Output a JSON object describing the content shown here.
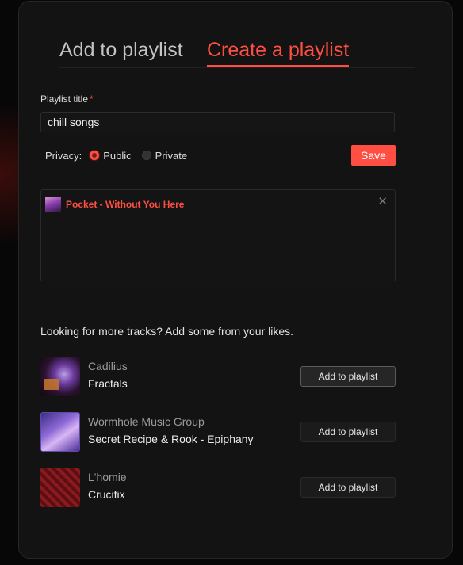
{
  "tabs": [
    {
      "label": "Add to playlist",
      "active": false
    },
    {
      "label": "Create a playlist",
      "active": true
    }
  ],
  "form": {
    "title_label": "Playlist title",
    "required_mark": "*",
    "title_value": "chill songs",
    "privacy_label": "Privacy:",
    "privacy_options": [
      "Public",
      "Private"
    ],
    "privacy_selected": "Public",
    "save_label": "Save"
  },
  "selected_tracks": [
    {
      "title": "Pocket - Without You Here",
      "remove_icon": "close-icon"
    }
  ],
  "suggestions": {
    "heading": "Looking for more tracks? Add some from your likes.",
    "items": [
      {
        "artist": "Cadilius",
        "title": "Fractals",
        "button": "Add to playlist"
      },
      {
        "artist": "Wormhole Music Group",
        "title": "Secret Recipe & Rook - Epiphany",
        "button": "Add to playlist"
      },
      {
        "artist": "L'homie",
        "title": "Crucifix",
        "button": "Add to playlist"
      }
    ]
  },
  "colors": {
    "accent": "#ff4e42",
    "panel": "#131313",
    "background": "#070707"
  }
}
